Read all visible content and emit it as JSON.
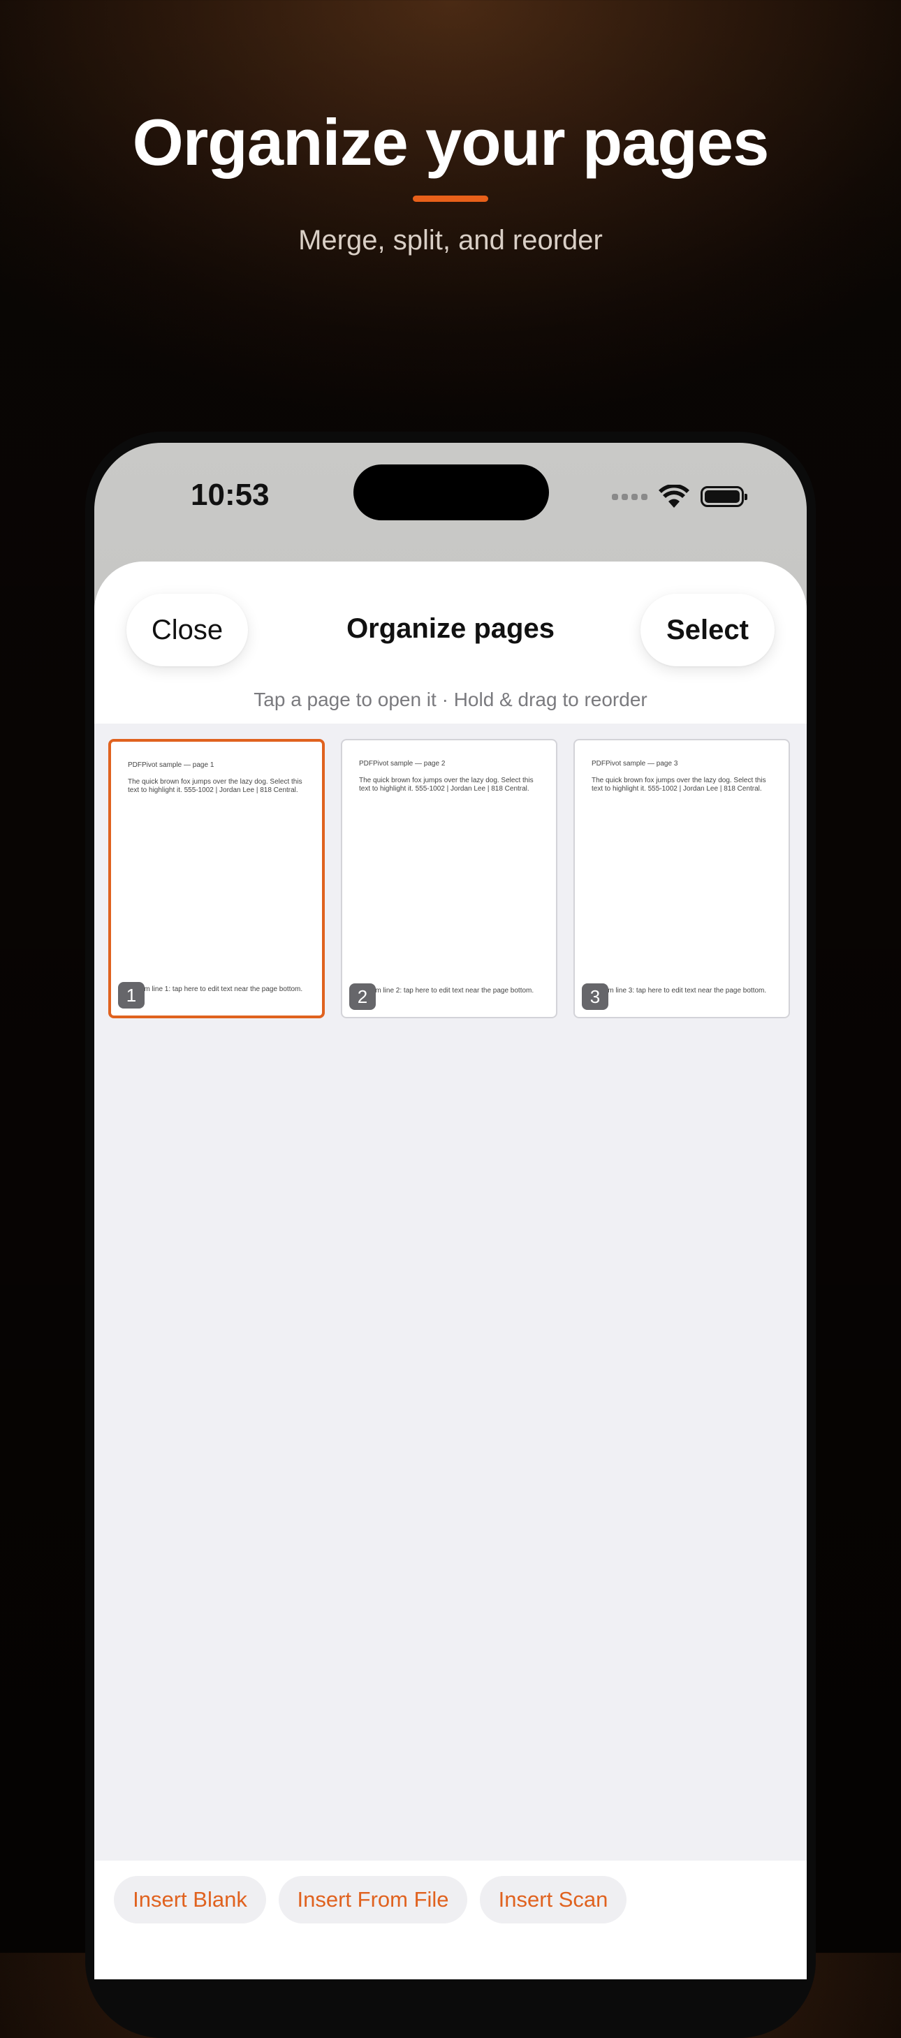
{
  "hero": {
    "title": "Organize your pages",
    "subtitle": "Merge, split, and reorder",
    "accent_color": "#e8601a"
  },
  "status_bar": {
    "time": "10:53",
    "icons": [
      "signal-icon",
      "wifi-icon",
      "battery-icon"
    ]
  },
  "sheet": {
    "close_label": "Close",
    "title": "Organize pages",
    "select_label": "Select",
    "hint": "Tap a page to open it  ·  Hold & drag to reorder"
  },
  "pages": [
    {
      "number": "1",
      "heading": "PDFPivot sample — page 1",
      "body": "The quick brown fox jumps over the lazy dog. Select this text to highlight it. 555-1002 | Jordan Lee | 818 Central.",
      "footer": "Bottom line 1: tap here to edit text near the page bottom.",
      "selected": true
    },
    {
      "number": "2",
      "heading": "PDFPivot sample — page 2",
      "body": "The quick brown fox jumps over the lazy dog. Select this text to highlight it. 555-1002 | Jordan Lee | 818 Central.",
      "footer": "Bottom line 2: tap here to edit text near the page bottom.",
      "selected": false
    },
    {
      "number": "3",
      "heading": "PDFPivot sample — page 3",
      "body": "The quick brown fox jumps over the lazy dog. Select this text to highlight it. 555-1002 | Jordan Lee | 818 Central.",
      "footer": "Bottom line 3: tap here to edit text near the page bottom.",
      "selected": false
    }
  ],
  "toolbar": {
    "insert_blank": "Insert Blank",
    "insert_from_file": "Insert From File",
    "insert_scan": "Insert Scan",
    "accent_color": "#e0621f"
  }
}
